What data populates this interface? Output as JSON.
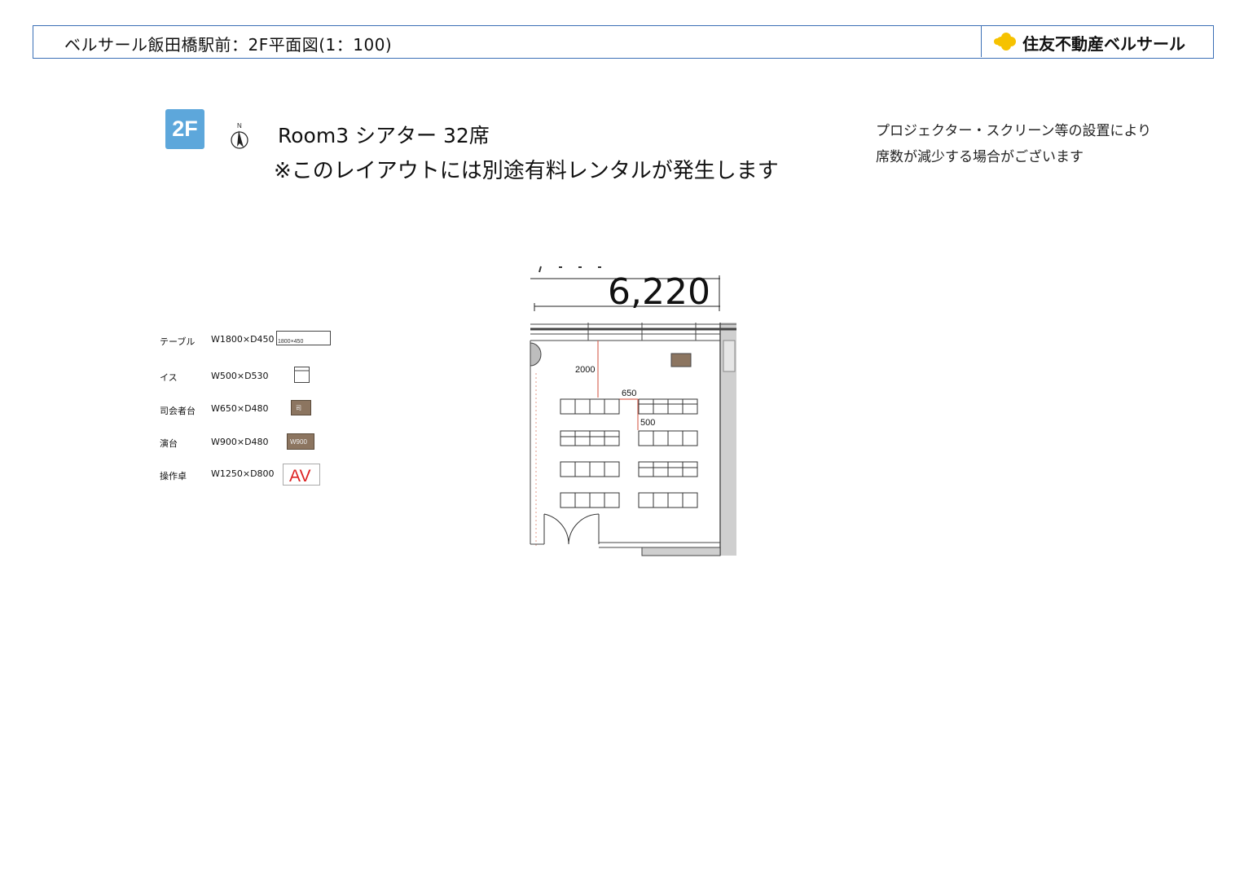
{
  "header": {
    "title": "ベルサール飯田橋駅前：2F平面図(1：100)",
    "brand": "住友不動産ベルサール",
    "brand_color": "#f6c200",
    "border_color": "#3b6fb6"
  },
  "room": {
    "floor_badge": "2F",
    "floor_badge_color": "#5da7db",
    "compass_label": "N",
    "title": "Room3 シアター 32席",
    "rental_note": "※このレイアウトには別途有料レンタルが発生します"
  },
  "notes": [
    "プロジェクター・スクリーン等の設置により",
    "席数が減少する場合がございます"
  ],
  "legend": [
    {
      "label": "テーブル",
      "size": "W1800×D450",
      "symbol_text": "1800×450",
      "icon": "table-icon"
    },
    {
      "label": "イス",
      "size": "W500×D530",
      "icon": "chair-icon"
    },
    {
      "label": "司会者台",
      "size": "W650×D480",
      "symbol_text": "司",
      "icon": "mc-stand-icon"
    },
    {
      "label": "演台",
      "size": "W900×D480",
      "symbol_text": "W900",
      "icon": "podium-icon"
    },
    {
      "label": "操作卓",
      "size": "W1250×D800",
      "symbol_text": "AV",
      "icon": "av-console-icon"
    }
  ],
  "plan": {
    "width_dimension": "6,220",
    "dim_front": "2000",
    "dim_aisle": "650",
    "dim_row": "500"
  }
}
